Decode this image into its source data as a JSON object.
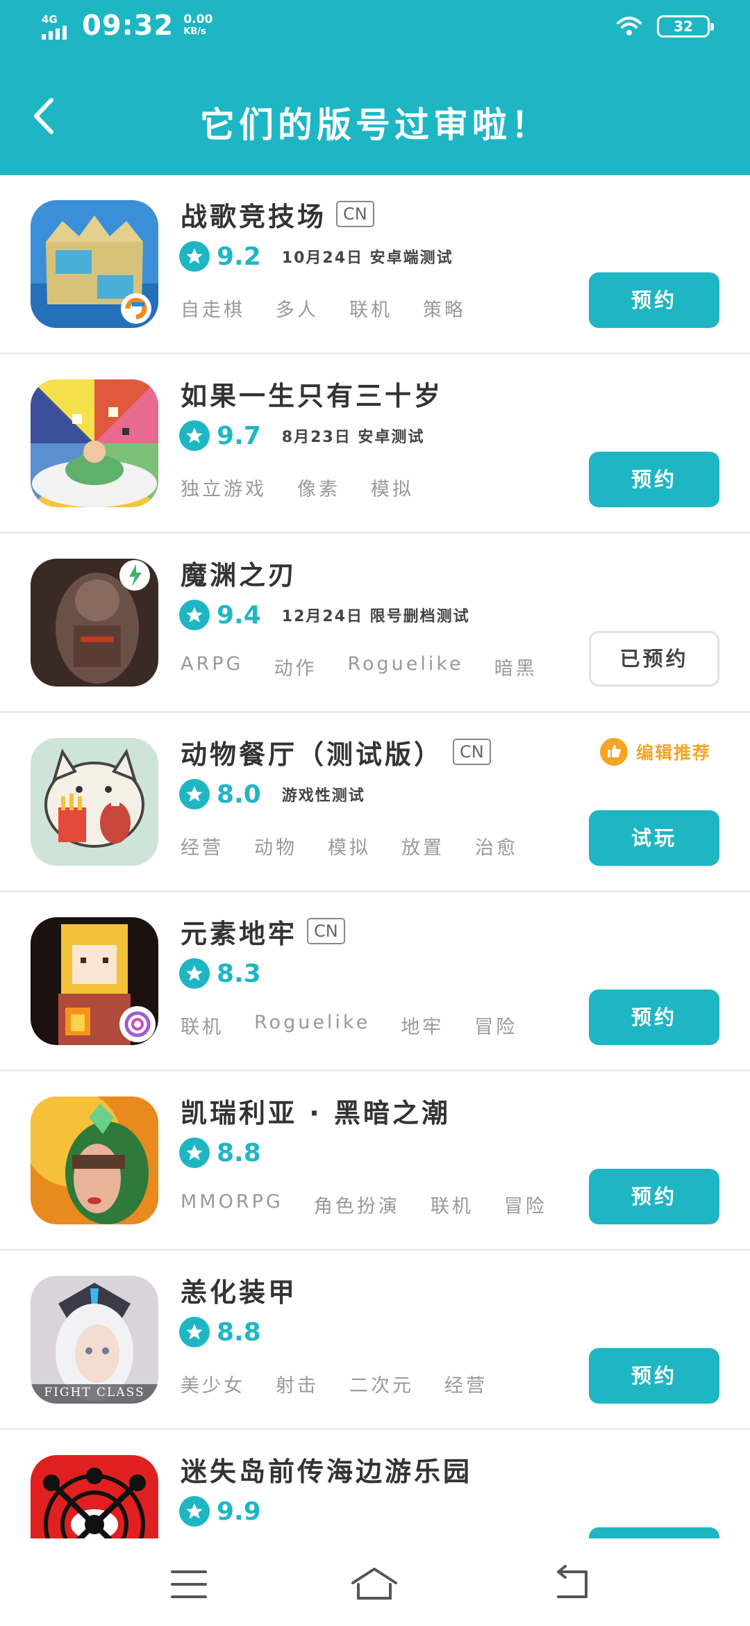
{
  "status_bar": {
    "network": "4G",
    "time": "09:32",
    "speed_value": "0.00",
    "speed_unit": "KB/s",
    "battery": "32"
  },
  "header": {
    "back_icon": "back-arrow-icon",
    "title": "它们的版号过审啦！"
  },
  "games": [
    {
      "name": "战歌竞技场",
      "cn": "CN",
      "score": "9.2",
      "date": "10月24日 安卓端测试",
      "tags": [
        "自走棋",
        "多人",
        "联机",
        "策略"
      ],
      "button": "预约",
      "button_state": "primary",
      "editor_pick": ""
    },
    {
      "name": "如果一生只有三十岁",
      "cn": "",
      "score": "9.7",
      "date": "8月23日 安卓测试",
      "tags": [
        "独立游戏",
        "像素",
        "模拟"
      ],
      "button": "预约",
      "button_state": "primary",
      "editor_pick": ""
    },
    {
      "name": "魔渊之刃",
      "cn": "",
      "score": "9.4",
      "date": "12月24日 限号删档测试",
      "tags": [
        "ARPG",
        "动作",
        "Roguelike",
        "暗黑"
      ],
      "button": "已预约",
      "button_state": "reserved",
      "editor_pick": ""
    },
    {
      "name": "动物餐厅（测试版）",
      "cn": "CN",
      "score": "8.0",
      "date": "游戏性测试",
      "tags": [
        "经营",
        "动物",
        "模拟",
        "放置",
        "治愈"
      ],
      "button": "试玩",
      "button_state": "primary",
      "editor_pick": "编辑推荐"
    },
    {
      "name": "元素地牢",
      "cn": "CN",
      "score": "8.3",
      "date": "",
      "tags": [
        "联机",
        "Roguelike",
        "地牢",
        "冒险"
      ],
      "button": "预约",
      "button_state": "primary",
      "editor_pick": ""
    },
    {
      "name": "凯瑞利亚 · 黑暗之潮",
      "cn": "",
      "score": "8.8",
      "date": "",
      "tags": [
        "MMORPG",
        "角色扮演",
        "联机",
        "冒险"
      ],
      "button": "预约",
      "button_state": "primary",
      "editor_pick": ""
    },
    {
      "name": "恙化装甲",
      "cn": "",
      "score": "8.8",
      "date": "",
      "tags": [
        "美少女",
        "射击",
        "二次元",
        "经营"
      ],
      "button": "预约",
      "button_state": "primary",
      "editor_pick": ""
    },
    {
      "name": "迷失岛前传海边游乐园",
      "cn": "",
      "score": "9.9",
      "date": "",
      "tags": [],
      "button": "",
      "button_state": "primary",
      "editor_pick": ""
    }
  ],
  "icon_texts": {
    "game7": "FIGHT CLASS"
  },
  "nav_bar": {
    "menu_icon": "menu-icon",
    "home_icon": "home-icon",
    "back_icon": "return-icon"
  },
  "colors": {
    "accent": "#1fb6c4",
    "editor_pick": "#f5a523",
    "tag_text": "#999999"
  }
}
